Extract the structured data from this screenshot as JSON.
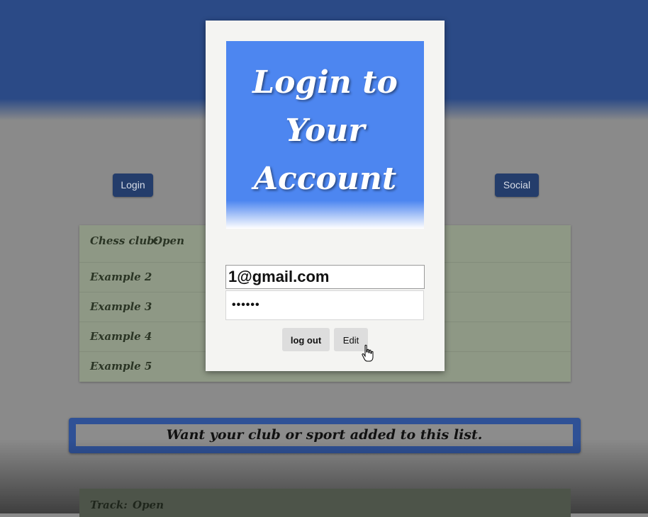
{
  "nav": {
    "login_label": "Login",
    "social_label": "Social"
  },
  "clubs": [
    {
      "name": "Chess club:",
      "status": "Open"
    },
    {
      "name": "Example 2",
      "status": ""
    },
    {
      "name": "Example 3",
      "status": ""
    },
    {
      "name": "Example 4",
      "status": ""
    },
    {
      "name": "Example 5",
      "status": ""
    }
  ],
  "banner": {
    "text": "Want your club or sport added to this list."
  },
  "track": {
    "name": "Track:",
    "status": "Open"
  },
  "modal": {
    "title": "Login to Your Account",
    "email_value": "1@gmail.com",
    "password_value": "••••••",
    "logout_label": "log out",
    "edit_label": "Edit"
  },
  "colors": {
    "header_blue": "#2b4a86",
    "modal_hero_blue": "#4d86f0",
    "banner_blue": "#2f5196",
    "nav_button": "#243d6b"
  },
  "icons": {
    "cursor": "hand-pointer-icon"
  }
}
